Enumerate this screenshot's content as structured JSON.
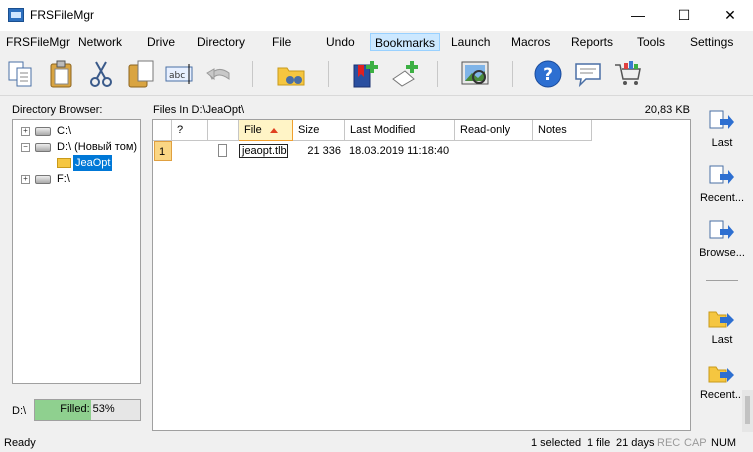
{
  "window": {
    "title": "FRSFileMgr"
  },
  "menu": [
    "FRSFileMgr",
    "Network",
    "Drive",
    "Directory",
    "File",
    "Undo",
    "Bookmarks",
    "Launch",
    "Macros",
    "Reports",
    "Tools",
    "Settings"
  ],
  "toolbar_icons": [
    "copy-icon",
    "paste-icon",
    "cut-icon",
    "copy-to-icon",
    "rename-icon",
    "undo-icon",
    "find-icon",
    "add-bookmark-icon",
    "bookmark-item-icon",
    "image-viewer-icon",
    "help-icon",
    "chat-icon",
    "shop-icon"
  ],
  "directory_browser": {
    "label": "Directory Browser:",
    "nodes": [
      {
        "label": "C:\\",
        "type": "drive"
      },
      {
        "label": "D:\\ (Новый том)",
        "type": "drive"
      },
      {
        "label": "JeaOpt",
        "type": "folder",
        "selected": true
      },
      {
        "label": "F:\\",
        "type": "network-drive"
      }
    ]
  },
  "drive_status": {
    "drive": "D:\\",
    "text": "Filled:  53%",
    "fill_fraction": 0.53
  },
  "files": {
    "label": "Files In D:\\JeaOpt\\",
    "total_size": "20,83 KB",
    "columns": [
      "",
      "?",
      "",
      "File",
      "Size",
      "Last Modified",
      "Read-only",
      "Notes"
    ],
    "rows": [
      {
        "num": "1",
        "name": "jeaopt.tlb",
        "size": "21 336",
        "modified": "18.03.2019 11:18:40",
        "readonly": "",
        "notes": ""
      }
    ]
  },
  "right_panel": {
    "buttons": [
      {
        "label": "Last",
        "icon": "copy-to-last-icon"
      },
      {
        "label": "Recent...",
        "icon": "copy-to-recent-icon"
      },
      {
        "label": "Browse...",
        "icon": "copy-to-browse-icon"
      },
      {
        "label": "Last",
        "icon": "move-to-last-icon"
      },
      {
        "label": "Recent...",
        "icon": "move-to-recent-icon"
      }
    ]
  },
  "status": {
    "left": "Ready",
    "selected": "1 selected",
    "files": "1 file",
    "days": "21 days",
    "rec": "REC",
    "cap": "CAP",
    "num": "NUM"
  }
}
